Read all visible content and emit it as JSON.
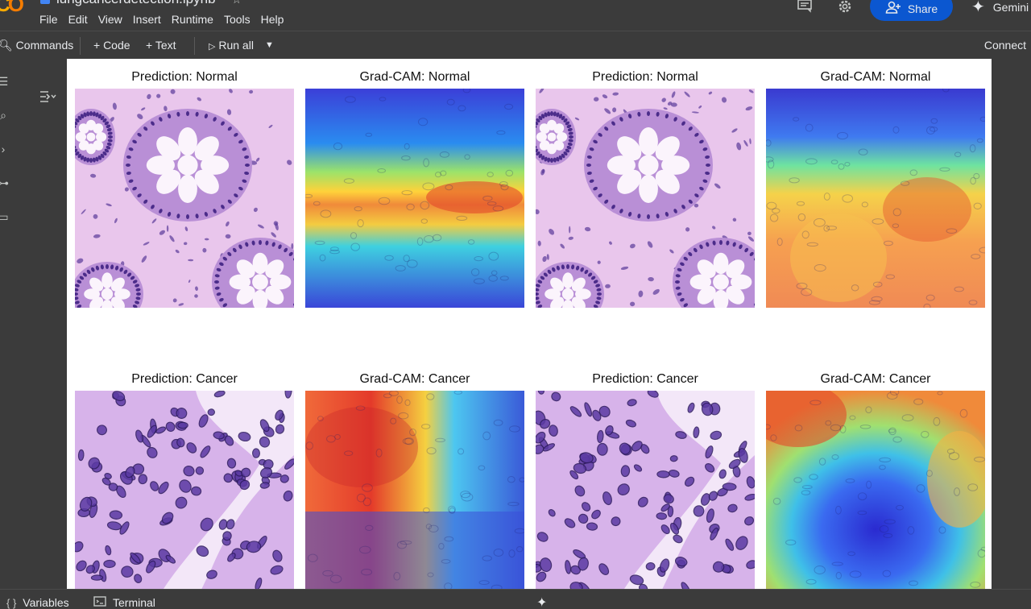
{
  "app": {
    "logo_text": "CO",
    "notebook_title": "lungcancerdetection.ipynb"
  },
  "menu": [
    "File",
    "Edit",
    "View",
    "Insert",
    "Runtime",
    "Tools",
    "Help"
  ],
  "header": {
    "share_label": "Share",
    "gemini_label": "Gemini"
  },
  "toolbar": {
    "commands_label": "Commands",
    "code_label": "+ Code",
    "text_label": "+ Text",
    "run_all_label": "Run all",
    "connect_label": "Connect"
  },
  "output": {
    "panels": [
      {
        "title": "Prediction: Normal",
        "kind": "histology-normal"
      },
      {
        "title": "Grad-CAM: Normal",
        "kind": "gradcam-band"
      },
      {
        "title": "Prediction: Normal",
        "kind": "histology-normal"
      },
      {
        "title": "Grad-CAM: Normal",
        "kind": "gradcam-lower"
      },
      {
        "title": "Prediction: Cancer",
        "kind": "histology-cancer"
      },
      {
        "title": "Grad-CAM: Cancer",
        "kind": "gradcam-left"
      },
      {
        "title": "Prediction: Cancer",
        "kind": "histology-cancer"
      },
      {
        "title": "Grad-CAM: Cancer",
        "kind": "gradcam-center"
      }
    ]
  },
  "bottom": {
    "variables_label": "Variables",
    "terminal_label": "Terminal"
  },
  "colors": {
    "chrome_bg": "#3b3b3b",
    "share_blue": "#0b57d0",
    "tissue_pink": "#e6b8e6",
    "nuclei_purple": "#4b2c8a"
  }
}
